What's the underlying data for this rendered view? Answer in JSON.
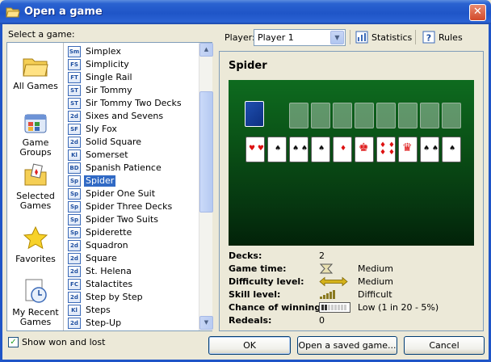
{
  "window": {
    "title": "Open a game",
    "close_glyph": "✕"
  },
  "left": {
    "select_label": "Select a game:",
    "categories": [
      {
        "label_line1": "All Games",
        "label_line2": ""
      },
      {
        "label_line1": "Game",
        "label_line2": "Groups"
      },
      {
        "label_line1": "Selected",
        "label_line2": "Games"
      },
      {
        "label_line1": "Favorites",
        "label_line2": ""
      },
      {
        "label_line1": "My Recent",
        "label_line2": "Games"
      }
    ],
    "games": [
      {
        "abbr": "Sm",
        "name": "Simplex"
      },
      {
        "abbr": "FS",
        "name": "Simplicity"
      },
      {
        "abbr": "FT",
        "name": "Single Rail"
      },
      {
        "abbr": "ST",
        "name": "Sir Tommy"
      },
      {
        "abbr": "ST",
        "name": "Sir Tommy Two Decks"
      },
      {
        "abbr": "2d",
        "name": "Sixes and Sevens"
      },
      {
        "abbr": "SF",
        "name": "Sly Fox"
      },
      {
        "abbr": "2d",
        "name": "Solid Square"
      },
      {
        "abbr": "Kl",
        "name": "Somerset"
      },
      {
        "abbr": "BD",
        "name": "Spanish Patience"
      },
      {
        "abbr": "Sp",
        "name": "Spider"
      },
      {
        "abbr": "Sp",
        "name": "Spider One Suit"
      },
      {
        "abbr": "Sp",
        "name": "Spider Three Decks"
      },
      {
        "abbr": "Sp",
        "name": "Spider Two Suits"
      },
      {
        "abbr": "Sp",
        "name": "Spiderette"
      },
      {
        "abbr": "2d",
        "name": "Squadron"
      },
      {
        "abbr": "2d",
        "name": "Square"
      },
      {
        "abbr": "2d",
        "name": "St. Helena"
      },
      {
        "abbr": "FC",
        "name": "Stalactites"
      },
      {
        "abbr": "2d",
        "name": "Step by Step"
      },
      {
        "abbr": "Kl",
        "name": "Steps"
      },
      {
        "abbr": "2d",
        "name": "Step-Up"
      }
    ],
    "selected_game": "Spider",
    "show_won_lost_label": "Show won and lost",
    "show_won_lost_checked": "✓"
  },
  "toolbar": {
    "player_label": "Player:",
    "player_value": "Player 1",
    "statistics_label": "Statistics",
    "rules_label": "Rules"
  },
  "details": {
    "game_name": "Spider",
    "stats": [
      {
        "key": "Decks:",
        "value": "2",
        "extra": ""
      },
      {
        "key": "Game time:",
        "value": "",
        "extra": "Medium"
      },
      {
        "key": "Difficulty level:",
        "value": "",
        "extra": "Medium"
      },
      {
        "key": "Skill level:",
        "value": "",
        "extra": "Difficult"
      },
      {
        "key": "Chance of winning:",
        "value": "",
        "extra": "Low  (1 in 20  -  5%)"
      },
      {
        "key": "Redeals:",
        "value": "0",
        "extra": ""
      }
    ]
  },
  "buttons": {
    "ok": "OK",
    "open_saved": "Open a saved game...",
    "cancel": "Cancel"
  },
  "colors": {
    "selection": "#316ac5",
    "title_bar": "#1f55c7",
    "felt": "#0a5016"
  }
}
